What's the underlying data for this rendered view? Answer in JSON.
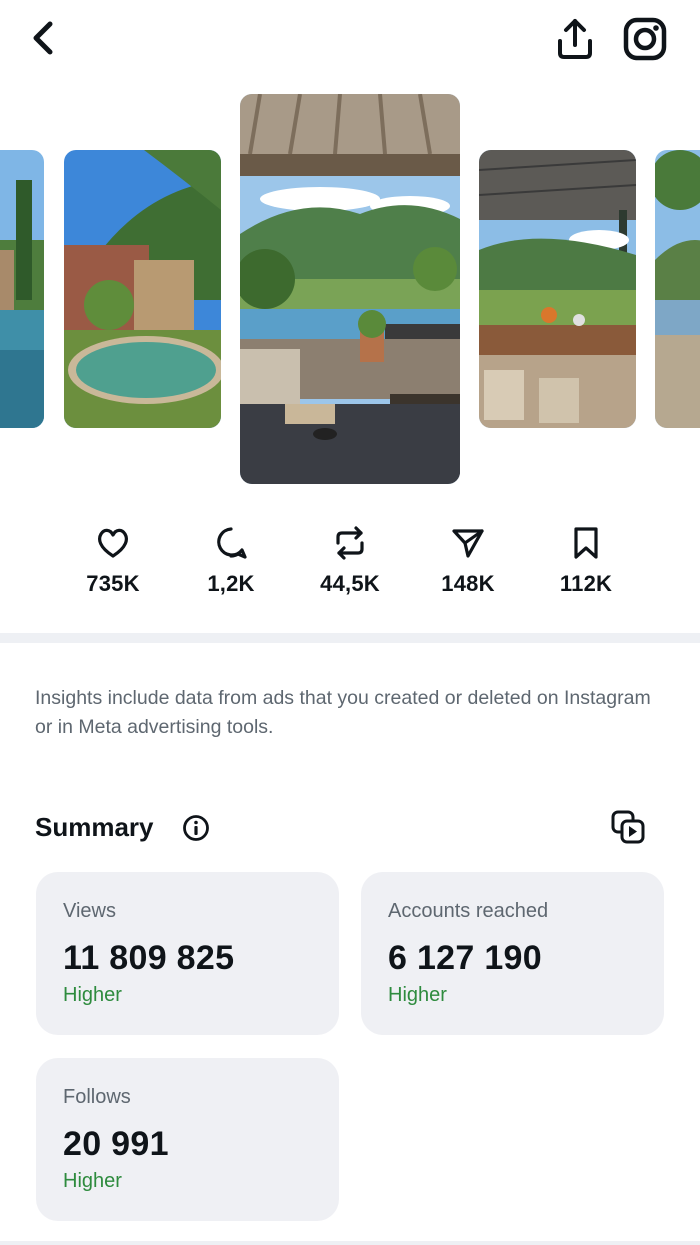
{
  "header": {
    "back_icon": "chevron-left-icon",
    "share_icon": "share-upload-icon",
    "instagram_icon": "instagram-icon"
  },
  "carousel": {
    "items": [
      {
        "name": "villa-pool-edge"
      },
      {
        "name": "stone-villa-oval-pool"
      },
      {
        "name": "pergola-mountain-view"
      },
      {
        "name": "outdoor-dining-pergola"
      },
      {
        "name": "poolside-partial"
      }
    ]
  },
  "stats": [
    {
      "icon": "heart-icon",
      "value": "735K"
    },
    {
      "icon": "comment-icon",
      "value": "1,2K"
    },
    {
      "icon": "repost-icon",
      "value": "44,5K"
    },
    {
      "icon": "send-icon",
      "value": "148K"
    },
    {
      "icon": "bookmark-icon",
      "value": "112K"
    }
  ],
  "notice": "Insights include data from ads that you created or deleted on Instagram or in Meta advertising tools.",
  "summary": {
    "title": "Summary",
    "info_icon": "info-icon",
    "copy_icon": "copy-reel-icon",
    "cards": [
      {
        "label": "Views",
        "value": "11 809 825",
        "trend": "Higher"
      },
      {
        "label": "Accounts reached",
        "value": "6 127 190",
        "trend": "Higher"
      },
      {
        "label": "Follows",
        "value": "20 991",
        "trend": "Higher"
      }
    ]
  },
  "colors": {
    "background": "#ffffff",
    "card": "#eff0f4",
    "positive": "#2e8b3e",
    "muted_text": "#5e6770"
  }
}
